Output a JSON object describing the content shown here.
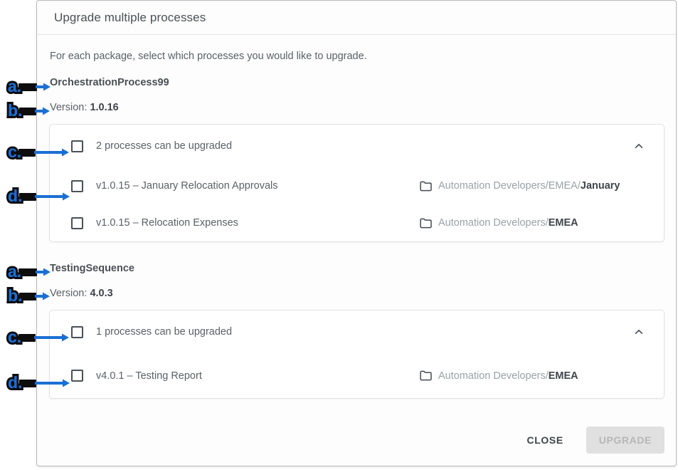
{
  "dialog": {
    "title": "Upgrade multiple processes",
    "intro": "For each package, select which processes you would like to upgrade.",
    "footer": {
      "close_label": "CLOSE",
      "upgrade_label": "UPGRADE"
    }
  },
  "packages": [
    {
      "name": "OrchestrationProcess99",
      "version_label": "Version:",
      "version_value": "1.0.16",
      "summary_label": "2 processes can be upgraded",
      "summary_checked": false,
      "collapse_icon": "chevron-up-icon",
      "processes": [
        {
          "label": "v1.0.15 – January Relocation Approvals",
          "checked": false,
          "folder_icon": "folder-icon",
          "path_prefix": "Automation Developers/EMEA/",
          "path_leaf": "January"
        },
        {
          "label": "v1.0.15 – Relocation Expenses",
          "checked": false,
          "folder_icon": "folder-icon",
          "path_prefix": "Automation Developers/",
          "path_leaf": "EMEA"
        }
      ]
    },
    {
      "name": "TestingSequence",
      "version_label": "Version:",
      "version_value": "4.0.3",
      "summary_label": "1 processes can be upgraded",
      "summary_checked": false,
      "collapse_icon": "chevron-up-icon",
      "processes": [
        {
          "label": "v4.0.1 – Testing Report",
          "checked": false,
          "folder_icon": "folder-icon",
          "path_prefix": "Automation Developers/",
          "path_leaf": "EMEA"
        }
      ]
    }
  ],
  "annotations": [
    {
      "id": "a1",
      "label": "a.",
      "target": "package-name-1"
    },
    {
      "id": "b1",
      "label": "b.",
      "target": "package-version-1"
    },
    {
      "id": "c1",
      "label": "c.",
      "target": "summary-checkbox-1"
    },
    {
      "id": "d1",
      "label": "d.",
      "target": "process-checkbox-1-1"
    },
    {
      "id": "a2",
      "label": "a.",
      "target": "package-name-2"
    },
    {
      "id": "b2",
      "label": "b.",
      "target": "package-version-2"
    },
    {
      "id": "c2",
      "label": "c.",
      "target": "summary-checkbox-2"
    },
    {
      "id": "d2",
      "label": "d.",
      "target": "process-checkbox-2-1"
    }
  ],
  "colors": {
    "marker_blue": "#1a6fd4",
    "marker_outline": "#0d0d0d",
    "text_primary": "#3f444b",
    "text_secondary": "#5b6067",
    "text_muted": "#9ba1a8",
    "disabled_button_bg": "#e0e0e0"
  }
}
